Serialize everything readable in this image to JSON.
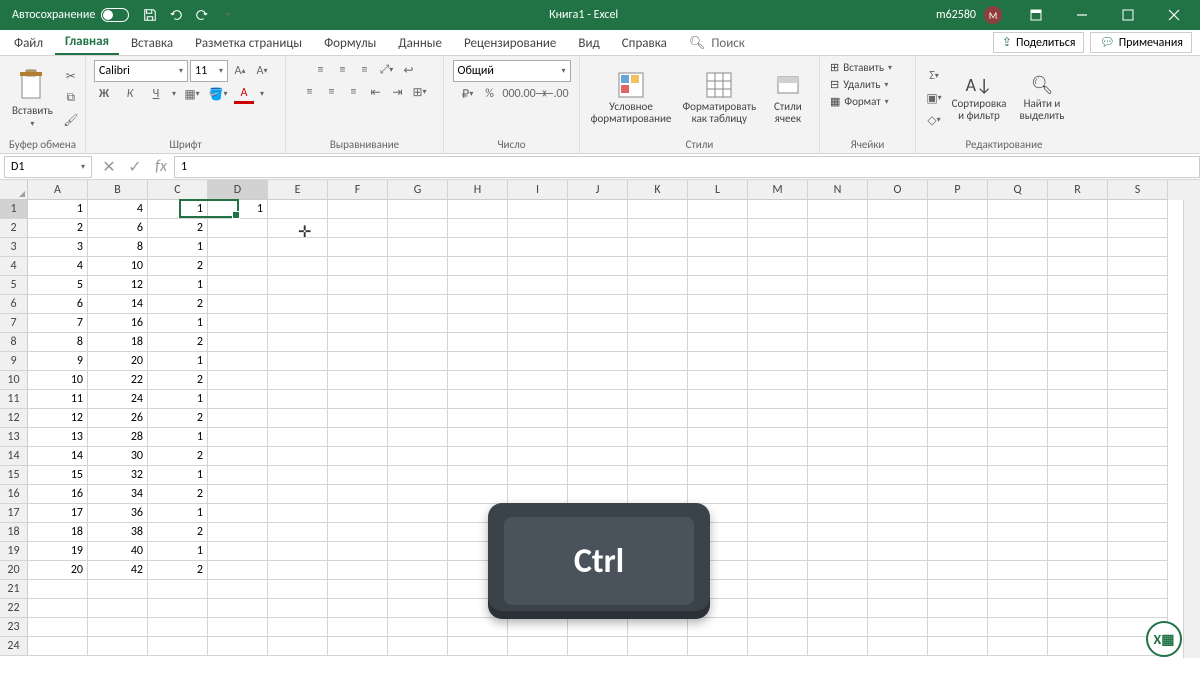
{
  "titlebar": {
    "autosave": "Автосохранение",
    "title": "Книга1 - Excel",
    "user": "m62580",
    "avatar": "M"
  },
  "tabs": {
    "items": [
      "Файл",
      "Главная",
      "Вставка",
      "Разметка страницы",
      "Формулы",
      "Данные",
      "Рецензирование",
      "Вид",
      "Справка"
    ],
    "active": 1,
    "search": "Поиск",
    "share": "Поделиться",
    "comments": "Примечания"
  },
  "ribbon": {
    "clipboard": {
      "label": "Буфер обмена",
      "paste": "Вставить"
    },
    "font": {
      "label": "Шрифт",
      "name": "Calibri",
      "size": "11"
    },
    "align": {
      "label": "Выравнивание"
    },
    "number": {
      "label": "Число",
      "format": "Общий"
    },
    "styles": {
      "label": "Стили",
      "cond": "Условное форматирование",
      "table": "Форматировать как таблицу",
      "cell": "Стили ячеек"
    },
    "cells": {
      "label": "Ячейки",
      "insert": "Вставить",
      "delete": "Удалить",
      "format": "Формат"
    },
    "editing": {
      "label": "Редактирование",
      "sort": "Сортировка и фильтр",
      "find": "Найти и выделить"
    }
  },
  "formula": {
    "cellref": "D1",
    "value": "1"
  },
  "columns": [
    "A",
    "B",
    "C",
    "D",
    "E",
    "F",
    "G",
    "H",
    "I",
    "J",
    "K",
    "L",
    "M",
    "N",
    "O",
    "P",
    "Q",
    "R",
    "S"
  ],
  "rows": [
    1,
    2,
    3,
    4,
    5,
    6,
    7,
    8,
    9,
    10,
    11,
    12,
    13,
    14,
    15,
    16,
    17,
    18,
    19,
    20,
    21,
    22,
    23,
    24
  ],
  "active": {
    "col": 3,
    "row": 0
  },
  "data": [
    [
      1,
      4,
      1,
      1
    ],
    [
      2,
      6,
      2,
      null
    ],
    [
      3,
      8,
      1,
      null
    ],
    [
      4,
      10,
      2,
      null
    ],
    [
      5,
      12,
      1,
      null
    ],
    [
      6,
      14,
      2,
      null
    ],
    [
      7,
      16,
      1,
      null
    ],
    [
      8,
      18,
      2,
      null
    ],
    [
      9,
      20,
      1,
      null
    ],
    [
      10,
      22,
      2,
      null
    ],
    [
      11,
      24,
      1,
      null
    ],
    [
      12,
      26,
      2,
      null
    ],
    [
      13,
      28,
      1,
      null
    ],
    [
      14,
      30,
      2,
      null
    ],
    [
      15,
      32,
      1,
      null
    ],
    [
      16,
      34,
      2,
      null
    ],
    [
      17,
      36,
      1,
      null
    ],
    [
      18,
      38,
      2,
      null
    ],
    [
      19,
      40,
      1,
      null
    ],
    [
      20,
      42,
      2,
      null
    ]
  ],
  "key_overlay": "Ctrl"
}
